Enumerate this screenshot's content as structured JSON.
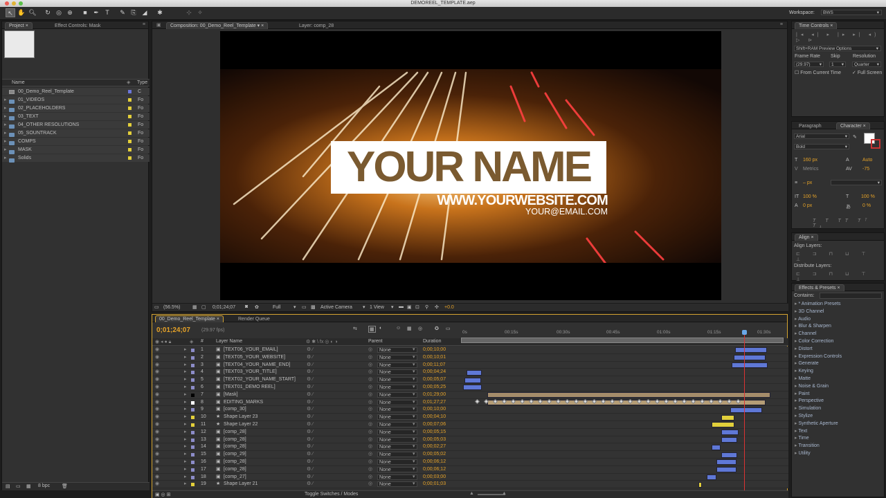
{
  "window": {
    "title": "DEMOREEL_TEMPLATE.aep"
  },
  "toolbar": {
    "workspace_label": "Workspace:",
    "workspace_value": "BWS"
  },
  "project_panel": {
    "tabs": [
      "Project",
      "Effect Controls: Mask"
    ],
    "columns": {
      "name": "Name",
      "type": "Type"
    },
    "items": [
      {
        "name": "00_Demo_Reel_Template",
        "type": "C",
        "kind": "comp",
        "label_color": "#6b76d8"
      },
      {
        "name": "01_VIDEOS",
        "type": "Fo",
        "kind": "folder",
        "label_color": "#e3cf3a"
      },
      {
        "name": "02_PLACEHOLDERS",
        "type": "Fo",
        "kind": "folder",
        "label_color": "#e3cf3a"
      },
      {
        "name": "03_TEXT",
        "type": "Fo",
        "kind": "folder",
        "label_color": "#e3cf3a"
      },
      {
        "name": "04_OTHER RESOLUTIONS",
        "type": "Fo",
        "kind": "folder",
        "label_color": "#e3cf3a"
      },
      {
        "name": "05_SOUNTRACK",
        "type": "Fo",
        "kind": "folder",
        "label_color": "#e3cf3a"
      },
      {
        "name": "COMPS",
        "type": "Fo",
        "kind": "folder",
        "label_color": "#e3cf3a"
      },
      {
        "name": "MASK",
        "type": "Fo",
        "kind": "folder",
        "label_color": "#e3cf3a"
      },
      {
        "name": "Solids",
        "type": "Fo",
        "kind": "folder",
        "label_color": "#e3cf3a"
      }
    ],
    "footer_bpc": "8 bpc"
  },
  "comp_viewer": {
    "tabs": [
      "Composition: 00_Demo_Reel_Template",
      "Layer: comp_28"
    ],
    "preview": {
      "name": "YOUR NAME",
      "website": "WWW.YOURWEBSITE.COM",
      "email": "YOUR@EMAIL.COM"
    },
    "footer": {
      "zoom": "(56.5%)",
      "timecode": "0;01;24;07",
      "resolution": "Full",
      "camera": "Active Camera",
      "views": "1 View",
      "exposure": "+0.0"
    }
  },
  "timeline": {
    "tabs": [
      "00_Demo_Reel_Template",
      "Render Queue"
    ],
    "current_time": "0;01;24;07",
    "fps": "(29.97 fps)",
    "columns": {
      "num": "#",
      "layer_name": "Layer Name",
      "parent": "Parent",
      "duration": "Duration"
    },
    "ruler": [
      "0s",
      "00:15s",
      "00:30s",
      "00:45s",
      "01:00s",
      "01:15s",
      "01:30s"
    ],
    "footer": "Toggle Switches / Modes",
    "layers": [
      {
        "num": "1",
        "name": "[TEXT06_YOUR_EMAIL]",
        "parent": "None",
        "duration": "0;00;10;00",
        "label": "#8c8cc8",
        "bar_color": "#5f78d6",
        "bar_start": 85.5,
        "bar_end": 95.5
      },
      {
        "num": "2",
        "name": "[TEXT05_YOUR_WEBSITE]",
        "parent": "None",
        "duration": "0;00;10;01",
        "label": "#8c8cc8",
        "bar_color": "#5f78d6",
        "bar_start": 85.0,
        "bar_end": 95.1
      },
      {
        "num": "3",
        "name": "[TEXT04_YOUR_NAME_END]",
        "parent": "None",
        "duration": "0;00;11;07",
        "label": "#8c8cc8",
        "bar_color": "#5f78d6",
        "bar_start": 84.4,
        "bar_end": 95.6
      },
      {
        "num": "4",
        "name": "[TEXT03_YOUR_TITLE]",
        "parent": "None",
        "duration": "0;00;04;24",
        "label": "#8c8cc8",
        "bar_color": "#5f78d6",
        "bar_start": 1.0,
        "bar_end": 5.8
      },
      {
        "num": "5",
        "name": "[TEXT02_YOUR_NAME_START]",
        "parent": "None",
        "duration": "0;00;05;07",
        "label": "#8c8cc8",
        "bar_color": "#5f78d6",
        "bar_start": 0.4,
        "bar_end": 5.6
      },
      {
        "num": "6",
        "name": "[TEXT01_DEMO REEL]",
        "parent": "None",
        "duration": "0;00;05;25",
        "label": "#8c8cc8",
        "bar_color": "#5f78d6",
        "bar_start": 0.0,
        "bar_end": 5.8
      },
      {
        "num": "7",
        "name": "[Mask]",
        "parent": "None",
        "duration": "0;01;29;00",
        "label": "#000000",
        "bar_color": "#a48c6a",
        "bar_start": 7.5,
        "bar_end": 96.5
      },
      {
        "num": "8",
        "name": "EDITING_MARKS",
        "parent": "None",
        "duration": "0;01;27;27",
        "label": "#ffffff",
        "bar_color": "#b59d76",
        "bar_start": 7.5,
        "bar_end": 95.0
      },
      {
        "num": "9",
        "name": "[comp_30]",
        "parent": "None",
        "duration": "0;00;10;00",
        "label": "#8c8cc8",
        "bar_color": "#5f78d6",
        "bar_start": 84.0,
        "bar_end": 94.0
      },
      {
        "num": "10",
        "name": "Shape Layer 23",
        "parent": "None",
        "duration": "0;00;04;10",
        "label": "#e3cf3a",
        "bar_color": "#e1cf3b",
        "bar_start": 81.0,
        "bar_end": 85.3
      },
      {
        "num": "11",
        "name": "Shape Layer 22",
        "parent": "None",
        "duration": "0;00;07;06",
        "label": "#e3cf3a",
        "bar_color": "#e1cf3b",
        "bar_start": 78.0,
        "bar_end": 85.2
      },
      {
        "num": "12",
        "name": "[comp_28]",
        "parent": "None",
        "duration": "0;00;05;15",
        "label": "#8c8cc8",
        "bar_color": "#5f78d6",
        "bar_start": 81.0,
        "bar_end": 86.5
      },
      {
        "num": "13",
        "name": "[comp_28]",
        "parent": "None",
        "duration": "0;00;05;03",
        "label": "#8c8cc8",
        "bar_color": "#5f78d6",
        "bar_start": 81.0,
        "bar_end": 86.1
      },
      {
        "num": "14",
        "name": "[comp_28]",
        "parent": "None",
        "duration": "0;00;02;27",
        "label": "#8c8cc8",
        "bar_color": "#5f78d6",
        "bar_start": 78.0,
        "bar_end": 80.9
      },
      {
        "num": "15",
        "name": "[comp_29]",
        "parent": "None",
        "duration": "0;00;05;02",
        "label": "#8c8cc8",
        "bar_color": "#5f78d6",
        "bar_start": 81.0,
        "bar_end": 86.1
      },
      {
        "num": "16",
        "name": "[comp_28]",
        "parent": "None",
        "duration": "0;00;06;12",
        "label": "#8c8cc8",
        "bar_color": "#5f78d6",
        "bar_start": 79.5,
        "bar_end": 85.9
      },
      {
        "num": "17",
        "name": "[comp_28]",
        "parent": "None",
        "duration": "0;00;06;12",
        "label": "#8c8cc8",
        "bar_color": "#5f78d6",
        "bar_start": 79.5,
        "bar_end": 85.9
      },
      {
        "num": "18",
        "name": "[comp_27]",
        "parent": "None",
        "duration": "0;00;03;00",
        "label": "#8c8cc8",
        "bar_color": "#5f78d6",
        "bar_start": 76.5,
        "bar_end": 79.5
      },
      {
        "num": "19",
        "name": "Shape Layer 21",
        "parent": "None",
        "duration": "0;00;01;03",
        "label": "#e3cf3a",
        "bar_color": "#e1cf3b",
        "bar_start": 74.0,
        "bar_end": 75.1
      }
    ]
  },
  "time_controls": {
    "tab": "Time Controls",
    "preview_options": "Shift+RAM Preview Options",
    "labels": {
      "frame_rate": "Frame Rate",
      "skip": "Skip",
      "resolution": "Resolution"
    },
    "values": {
      "frame_rate": "(29.97)",
      "skip": "1",
      "resolution": "Quarter"
    },
    "from_current_time": "From Current Time",
    "full_screen": "Full Screen"
  },
  "character": {
    "tabs": [
      "Paragraph",
      "Character"
    ],
    "font": "Arial",
    "style": "Bold",
    "size": "160 px",
    "leading": "Auto",
    "kerning": "Metrics",
    "tracking": "-75",
    "stroke_width": "– px",
    "vscale": "100 %",
    "hscale": "100 %",
    "baseline": "0 px",
    "tsume": "0 %"
  },
  "align": {
    "tab": "Align",
    "align_layers": "Align Layers:",
    "distribute_layers": "Distribute Layers:"
  },
  "effects": {
    "tab": "Effects & Presets",
    "contains": "Contains:",
    "items": [
      "* Animation Presets",
      "3D Channel",
      "Audio",
      "Blur & Sharpen",
      "Channel",
      "Color Correction",
      "Distort",
      "Expression Controls",
      "Generate",
      "Keying",
      "Matte",
      "Noise & Grain",
      "Paint",
      "Perspective",
      "Simulation",
      "Stylize",
      "Synthetic Aperture",
      "Text",
      "Time",
      "Transition",
      "Utility"
    ]
  }
}
